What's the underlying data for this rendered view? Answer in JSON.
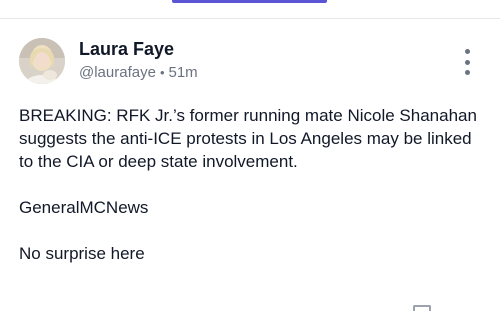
{
  "colors": {
    "tab_indicator": "#5b55d6",
    "text_primary": "#111827",
    "text_secondary": "#6b7280",
    "divider": "#e5e7eb"
  },
  "post": {
    "author": {
      "name": "Laura Faye",
      "handle": "@laurafaye",
      "separator": "•",
      "time": "51m",
      "avatar_icon": "avatar-photo"
    },
    "menu_icon": "more-vertical-icon",
    "body": [
      "BREAKING: RFK Jr.’s former running mate Nicole Shanahan suggests the anti-ICE protests in Los Angeles may be linked to the CIA or deep state involvement.",
      "GeneralMCNews",
      "No surprise here"
    ]
  }
}
